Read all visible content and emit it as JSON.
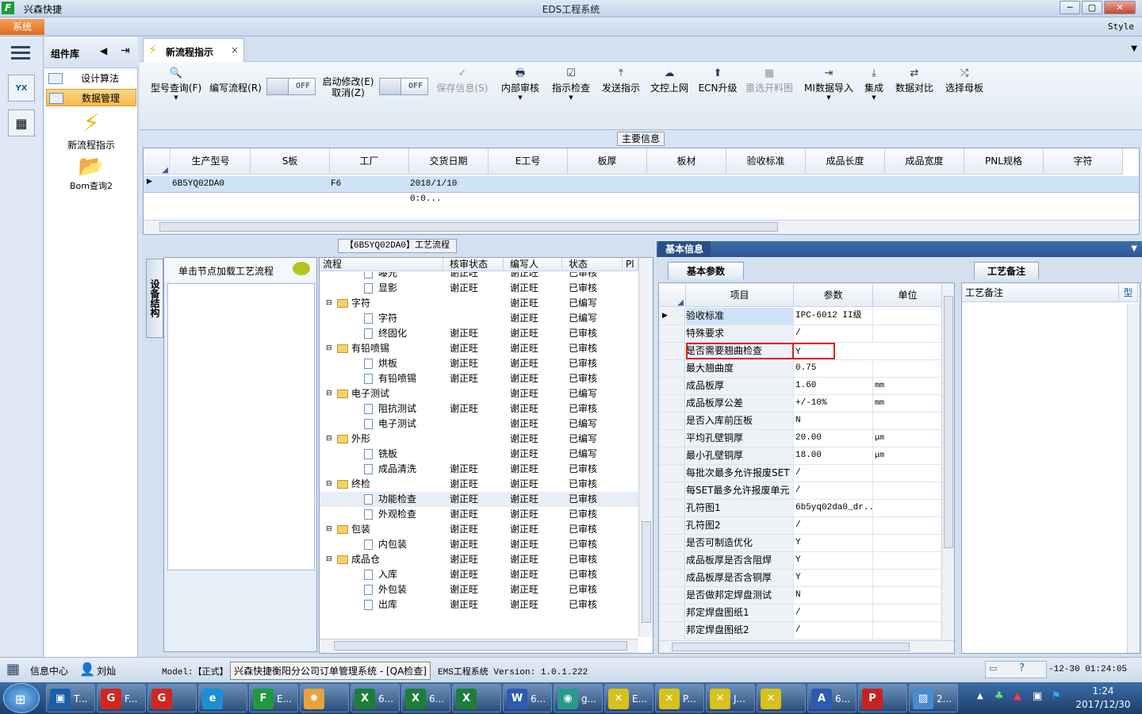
{
  "window": {
    "app_name": "兴森快捷",
    "title": "EDS工程系统",
    "min": "─",
    "max": "▢",
    "close": "✕"
  },
  "menu": {
    "system": "系统",
    "style": "Style"
  },
  "component_panel": {
    "title": "组件库",
    "items": [
      {
        "label": "设计算法"
      },
      {
        "label": "数据管理"
      }
    ],
    "big_items": [
      {
        "label": "新流程指示"
      },
      {
        "label": "Bom查询2"
      }
    ]
  },
  "tab": {
    "label": "新流程指示",
    "close": "×"
  },
  "toolbar": {
    "buttons": [
      {
        "label": "型号查询(F)",
        "icon": "🔍"
      },
      {
        "label": "编写流程(R)"
      },
      {
        "label": "启动修改(E)",
        "label2": "取消(Z)"
      },
      {
        "label": "保存信息(S)",
        "icon": "✓"
      },
      {
        "label": "内部审核",
        "icon": "🖶"
      },
      {
        "label": "指示检查",
        "icon": "☑"
      },
      {
        "label": "发送指示",
        "icon": "⤒"
      },
      {
        "label": "文控上网",
        "icon": "☁"
      },
      {
        "label": "ECN升级",
        "icon": "⬆"
      },
      {
        "label": "重选开料图",
        "icon": "▦"
      },
      {
        "label": "MI数据导入",
        "icon": "⇥"
      },
      {
        "label": "集成",
        "icon": "⤓"
      },
      {
        "label": "数据对比",
        "icon": "⇄"
      },
      {
        "label": "选择母板",
        "icon": "⤮"
      }
    ],
    "toggle_off": "OFF"
  },
  "main_info": {
    "title": "主要信息",
    "columns": [
      "生产型号",
      "S板",
      "工厂",
      "交货日期",
      "E工号",
      "板厚",
      "板材",
      "验收标准",
      "成品长度",
      "成品宽度",
      "PNL规格",
      "字符"
    ],
    "row": {
      "model": "6B5YQ02DA0",
      "factory": "F6",
      "date": "2018/1/10 0:0..."
    }
  },
  "process": {
    "title": "【6B5YQ02DA0】工艺流程",
    "side_tab": "设备结构",
    "hint": "单击节点加载工艺流程",
    "columns": [
      "流程",
      "核审状态",
      "编写人",
      "状态",
      "Pl"
    ],
    "rows": [
      {
        "name": "曝光",
        "level": 2,
        "type": "doc",
        "review": "谢正旺",
        "author": "谢正旺",
        "status": "已审核"
      },
      {
        "name": "显影",
        "level": 2,
        "type": "doc",
        "review": "谢正旺",
        "author": "谢正旺",
        "status": "已审核"
      },
      {
        "name": "字符",
        "level": 1,
        "type": "folder",
        "review": "",
        "author": "谢正旺",
        "status": "已编写"
      },
      {
        "name": "字符",
        "level": 2,
        "type": "doc",
        "review": "",
        "author": "谢正旺",
        "status": "已编写"
      },
      {
        "name": "终固化",
        "level": 2,
        "type": "doc",
        "review": "谢正旺",
        "author": "谢正旺",
        "status": "已审核"
      },
      {
        "name": "有铅喷锡",
        "level": 1,
        "type": "folder",
        "review": "谢正旺",
        "author": "谢正旺",
        "status": "已审核"
      },
      {
        "name": "烘板",
        "level": 2,
        "type": "doc",
        "review": "谢正旺",
        "author": "谢正旺",
        "status": "已审核"
      },
      {
        "name": "有铅喷锡",
        "level": 2,
        "type": "doc",
        "review": "谢正旺",
        "author": "谢正旺",
        "status": "已审核"
      },
      {
        "name": "电子测试",
        "level": 1,
        "type": "folder",
        "review": "",
        "author": "谢正旺",
        "status": "已编写"
      },
      {
        "name": "阻抗测试",
        "level": 2,
        "type": "doc",
        "review": "谢正旺",
        "author": "谢正旺",
        "status": "已审核"
      },
      {
        "name": "电子测试",
        "level": 2,
        "type": "doc",
        "review": "",
        "author": "谢正旺",
        "status": "已编写"
      },
      {
        "name": "外形",
        "level": 1,
        "type": "folder",
        "review": "",
        "author": "谢正旺",
        "status": "已编写"
      },
      {
        "name": "铣板",
        "level": 2,
        "type": "doc",
        "review": "",
        "author": "谢正旺",
        "status": "已编写"
      },
      {
        "name": "成品清洗",
        "level": 2,
        "type": "doc",
        "review": "谢正旺",
        "author": "谢正旺",
        "status": "已审核"
      },
      {
        "name": "终检",
        "level": 1,
        "type": "folder",
        "review": "谢正旺",
        "author": "谢正旺",
        "status": "已审核"
      },
      {
        "name": "功能检查",
        "level": 2,
        "type": "doc",
        "review": "谢正旺",
        "author": "谢正旺",
        "status": "已审核",
        "selected": true
      },
      {
        "name": "外观检查",
        "level": 2,
        "type": "doc",
        "review": "谢正旺",
        "author": "谢正旺",
        "status": "已审核"
      },
      {
        "name": "包装",
        "level": 1,
        "type": "folder",
        "review": "谢正旺",
        "author": "谢正旺",
        "status": "已审核"
      },
      {
        "name": "内包装",
        "level": 2,
        "type": "doc",
        "review": "谢正旺",
        "author": "谢正旺",
        "status": "已审核"
      },
      {
        "name": "成品仓",
        "level": 1,
        "type": "folder",
        "review": "谢正旺",
        "author": "谢正旺",
        "status": "已审核"
      },
      {
        "name": "入库",
        "level": 2,
        "type": "doc",
        "review": "谢正旺",
        "author": "谢正旺",
        "status": "已审核"
      },
      {
        "name": "外包装",
        "level": 2,
        "type": "doc",
        "review": "谢正旺",
        "author": "谢正旺",
        "status": "已审核"
      },
      {
        "name": "出库",
        "level": 2,
        "type": "doc",
        "review": "谢正旺",
        "author": "谢正旺",
        "status": "已审核"
      }
    ]
  },
  "basic_info": {
    "header": "基本信息",
    "subtab": "基本参数",
    "columns": [
      "项目",
      "参数",
      "单位"
    ],
    "rows": [
      {
        "item": "验收标准",
        "param": "IPC-6012 II级",
        "unit": ""
      },
      {
        "item": "特殊要求",
        "param": "/",
        "unit": ""
      },
      {
        "item": "是否需要翘曲检查",
        "param": "Y",
        "unit": "",
        "highlight": true
      },
      {
        "item": "最大翘曲度",
        "param": "0.75",
        "unit": ""
      },
      {
        "item": "成品板厚",
        "param": "1.60",
        "unit": "mm"
      },
      {
        "item": "成品板厚公差",
        "param": "+/-10%",
        "unit": "mm"
      },
      {
        "item": "是否入库前压板",
        "param": "N",
        "unit": ""
      },
      {
        "item": "平均孔壁铜厚",
        "param": "20.00",
        "unit": "μm"
      },
      {
        "item": "最小孔壁铜厚",
        "param": "18.00",
        "unit": "μm"
      },
      {
        "item": "每批次最多允许报废SET",
        "param": "/",
        "unit": ""
      },
      {
        "item": "每SET最多允许报废单元",
        "param": "/",
        "unit": ""
      },
      {
        "item": "孔符图1",
        "param": "6b5yq02da0_dr...",
        "unit": ""
      },
      {
        "item": "孔符图2",
        "param": "/",
        "unit": ""
      },
      {
        "item": "是否可制造优化",
        "param": "Y",
        "unit": ""
      },
      {
        "item": "成品板厚是否含阻焊",
        "param": "Y",
        "unit": ""
      },
      {
        "item": "成品板厚是否含铜厚",
        "param": "Y",
        "unit": ""
      },
      {
        "item": "是否做邦定焊盘测试",
        "param": "N",
        "unit": ""
      },
      {
        "item": "邦定焊盘图纸1",
        "param": "/",
        "unit": ""
      },
      {
        "item": "邦定焊盘图纸2",
        "param": "/",
        "unit": ""
      }
    ]
  },
  "notes": {
    "tab": "工艺备注",
    "col1": "工艺备注",
    "col2": "型"
  },
  "status": {
    "info_center": "信息中心",
    "user": "刘灿",
    "model_prefix": "Model:【正式】",
    "tooltip": "兴森快捷衡阳分公司订单管理系统 - [QA检查]",
    "system": "EMS工程系统  Version: 1.0.1.222",
    "datetime": "-12-30  01:24:05"
  },
  "taskbar": {
    "items": [
      {
        "label": "T..."
      },
      {
        "label": "F..."
      },
      {
        "label": ""
      },
      {
        "label": ""
      },
      {
        "label": "E..."
      },
      {
        "label": ""
      },
      {
        "label": "6..."
      },
      {
        "label": "6..."
      },
      {
        "label": ""
      },
      {
        "label": "6..."
      },
      {
        "label": "g..."
      },
      {
        "label": "E..."
      },
      {
        "label": "P..."
      },
      {
        "label": "J..."
      },
      {
        "label": ""
      },
      {
        "label": "6..."
      },
      {
        "label": ""
      },
      {
        "label": "2..."
      }
    ],
    "time": "1:24",
    "date": "2017/12/30"
  }
}
